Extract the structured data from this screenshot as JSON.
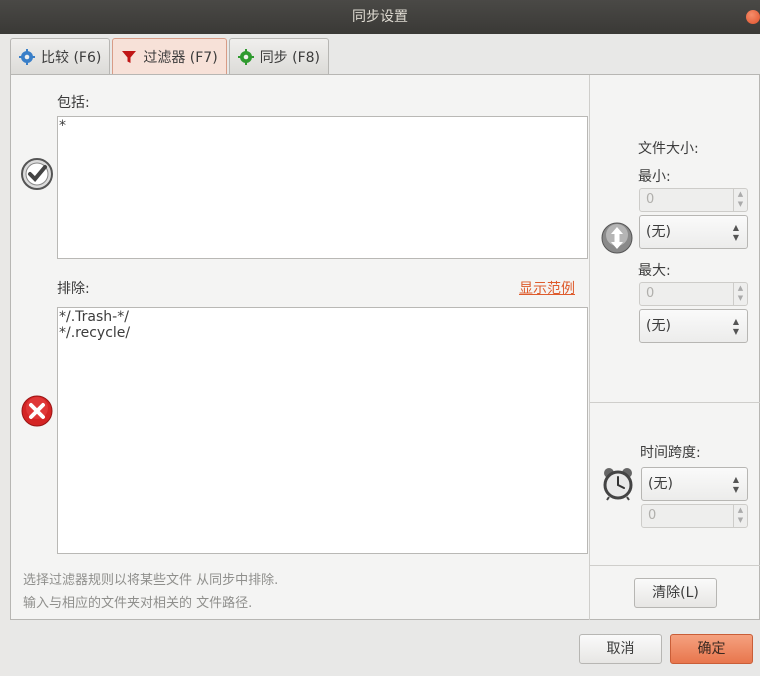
{
  "window": {
    "title": "同步设置"
  },
  "tabs": [
    {
      "label": "比较 (F6)",
      "icon": "gear-blue-icon"
    },
    {
      "label": "过滤器 (F7)",
      "icon": "funnel-icon",
      "active": true
    },
    {
      "label": "同步 (F8)",
      "icon": "gear-green-icon"
    }
  ],
  "filter": {
    "include_label": "包括:",
    "include_value": "*",
    "exclude_label": "排除:",
    "exclude_value": "*/.Trash-*/\n*/.recycle/",
    "show_examples": "显示范例",
    "hint_line1": "选择过滤器规则以将某些文件 从同步中排除.",
    "hint_line2": "输入与相应的文件夹对相关的 文件路径."
  },
  "size": {
    "title": "文件大小:",
    "min_label": "最小:",
    "min_value": "0",
    "min_unit": "(无)",
    "max_label": "最大:",
    "max_value": "0",
    "max_unit": "(无)"
  },
  "time": {
    "title": "时间跨度:",
    "unit": "(无)",
    "value": "0"
  },
  "buttons": {
    "clear": "清除(L)",
    "cancel": "取消",
    "ok": "确定"
  },
  "colors": {
    "accent": "#e8764d",
    "link": "#de5b2c",
    "titlebar": "#3f3e3b"
  }
}
